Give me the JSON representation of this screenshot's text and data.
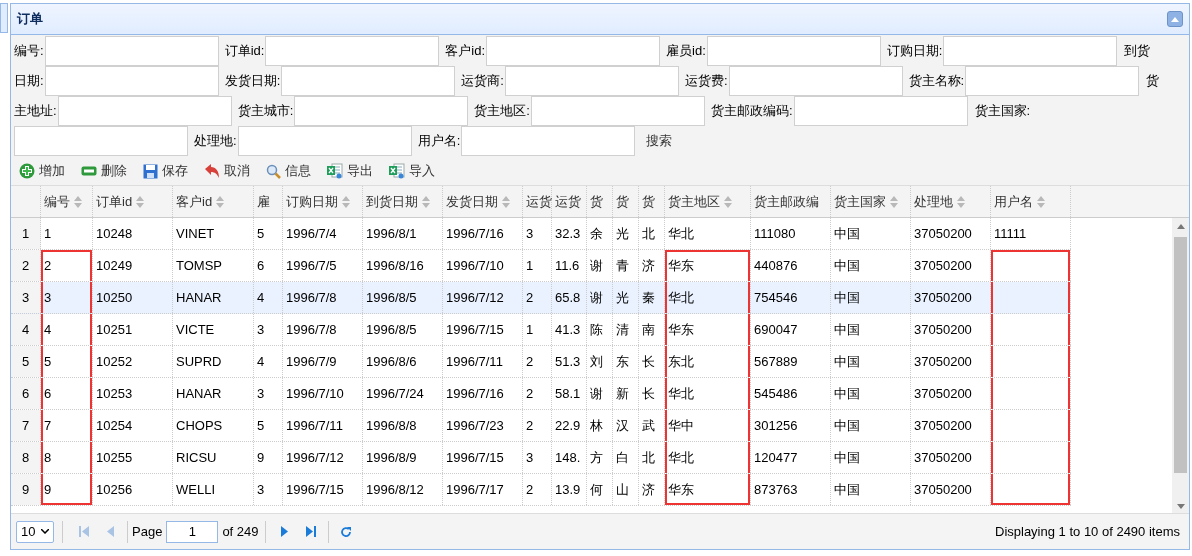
{
  "panel": {
    "title": "订单",
    "collapsed": false
  },
  "filter_rows": [
    [
      {
        "kind": "field",
        "label": "编号:"
      },
      {
        "kind": "field",
        "label": "订单id:"
      },
      {
        "kind": "field",
        "label": "客户id:"
      },
      {
        "kind": "field",
        "label": "雇员id:"
      },
      {
        "kind": "field",
        "label": "订购日期:"
      },
      {
        "kind": "label",
        "label": "到货"
      }
    ],
    [
      {
        "kind": "field",
        "label": "日期:"
      },
      {
        "kind": "field",
        "label": "发货日期:"
      },
      {
        "kind": "field",
        "label": "运货商:"
      },
      {
        "kind": "field",
        "label": "运货费:"
      },
      {
        "kind": "field",
        "label": "货主名称:"
      },
      {
        "kind": "label",
        "label": "货"
      }
    ],
    [
      {
        "kind": "field",
        "label": "主地址:"
      },
      {
        "kind": "field",
        "label": "货主城市:"
      },
      {
        "kind": "field",
        "label": "货主地区:"
      },
      {
        "kind": "field",
        "label": "货主邮政编码:"
      },
      {
        "kind": "label",
        "label": "货主国家:"
      }
    ],
    [
      {
        "kind": "input"
      },
      {
        "kind": "field",
        "label": "处理地:"
      },
      {
        "kind": "field",
        "label": "用户名:"
      },
      {
        "kind": "link",
        "label": "搜索"
      }
    ]
  ],
  "toolbar": [
    {
      "kind": "add",
      "label": "增加"
    },
    {
      "kind": "delete",
      "label": "删除"
    },
    {
      "kind": "save",
      "label": "保存"
    },
    {
      "kind": "cancel",
      "label": "取消"
    },
    {
      "kind": "info",
      "label": "信息"
    },
    {
      "kind": "export",
      "label": "导出"
    },
    {
      "kind": "import",
      "label": "导入"
    }
  ],
  "table": {
    "columns": [
      {
        "label": "编号",
        "sortable": true,
        "highlighted": true
      },
      {
        "label": "订单id",
        "sortable": true,
        "highlighted": false
      },
      {
        "label": "客户id",
        "sortable": true,
        "highlighted": false
      },
      {
        "label": "雇",
        "sortable": false,
        "highlighted": false
      },
      {
        "label": "订购日期",
        "sortable": true,
        "highlighted": false
      },
      {
        "label": "到货日期",
        "sortable": true,
        "highlighted": false
      },
      {
        "label": "发货日期",
        "sortable": true,
        "highlighted": false
      },
      {
        "label": "运货",
        "sortable": false,
        "highlighted": false
      },
      {
        "label": "运货",
        "sortable": false,
        "highlighted": false
      },
      {
        "label": "货",
        "sortable": false,
        "highlighted": false
      },
      {
        "label": "货",
        "sortable": false,
        "highlighted": false
      },
      {
        "label": "货",
        "sortable": false,
        "highlighted": false
      },
      {
        "label": "货主地区",
        "sortable": true,
        "highlighted": true
      },
      {
        "label": "货主邮政编",
        "sortable": false,
        "highlighted": false
      },
      {
        "label": "货主国家",
        "sortable": true,
        "highlighted": false
      },
      {
        "label": "处理地",
        "sortable": true,
        "highlighted": false
      },
      {
        "label": "用户名",
        "sortable": true,
        "highlighted": true
      }
    ],
    "rows": [
      {
        "number": "1",
        "selected": false,
        "highlighted": false,
        "cells": [
          "1",
          "10248",
          "VINET",
          "5",
          "1996/7/4",
          "1996/8/1",
          "1996/7/16",
          "3",
          "32.3",
          "余",
          "光",
          "北",
          "华北",
          "111080",
          "中国",
          "37050200",
          "11111"
        ]
      },
      {
        "number": "2",
        "selected": false,
        "highlighted": true,
        "cells": [
          "2",
          "10249",
          "TOMSP",
          "6",
          "1996/7/5",
          "1996/8/16",
          "1996/7/10",
          "1",
          "11.6",
          "谢",
          "青",
          "济",
          "华东",
          "440876",
          "中国",
          "37050200",
          ""
        ]
      },
      {
        "number": "3",
        "selected": true,
        "highlighted": true,
        "cells": [
          "3",
          "10250",
          "HANAR",
          "4",
          "1996/7/8",
          "1996/8/5",
          "1996/7/12",
          "2",
          "65.8",
          "谢",
          "光",
          "秦",
          "华北",
          "754546",
          "中国",
          "37050200",
          ""
        ]
      },
      {
        "number": "4",
        "selected": false,
        "highlighted": true,
        "cells": [
          "4",
          "10251",
          "VICTE",
          "3",
          "1996/7/8",
          "1996/8/5",
          "1996/7/15",
          "1",
          "41.3",
          "陈",
          "清",
          "南",
          "华东",
          "690047",
          "中国",
          "37050200",
          ""
        ]
      },
      {
        "number": "5",
        "selected": false,
        "highlighted": true,
        "cells": [
          "5",
          "10252",
          "SUPRD",
          "4",
          "1996/7/9",
          "1996/8/6",
          "1996/7/11",
          "2",
          "51.3",
          "刘",
          "东",
          "长",
          "东北",
          "567889",
          "中国",
          "37050200",
          ""
        ]
      },
      {
        "number": "6",
        "selected": false,
        "highlighted": true,
        "cells": [
          "6",
          "10253",
          "HANAR",
          "3",
          "1996/7/10",
          "1996/7/24",
          "1996/7/16",
          "2",
          "58.1",
          "谢",
          "新",
          "长",
          "华北",
          "545486",
          "中国",
          "37050200",
          ""
        ]
      },
      {
        "number": "7",
        "selected": false,
        "highlighted": true,
        "cells": [
          "7",
          "10254",
          "CHOPS",
          "5",
          "1996/7/11",
          "1996/8/8",
          "1996/7/23",
          "2",
          "22.9",
          "林",
          "汉",
          "武",
          "华中",
          "301256",
          "中国",
          "37050200",
          ""
        ]
      },
      {
        "number": "8",
        "selected": false,
        "highlighted": true,
        "cells": [
          "8",
          "10255",
          "RICSU",
          "9",
          "1996/7/12",
          "1996/8/9",
          "1996/7/15",
          "3",
          "148.",
          "方",
          "白",
          "北",
          "华北",
          "120477",
          "中国",
          "37050200",
          ""
        ]
      },
      {
        "number": "9",
        "selected": false,
        "highlighted": true,
        "cells": [
          "9",
          "10256",
          "WELLI",
          "3",
          "1996/7/15",
          "1996/8/12",
          "1996/7/17",
          "2",
          "13.9",
          "何",
          "山",
          "济",
          "华东",
          "873763",
          "中国",
          "37050200",
          ""
        ]
      }
    ]
  },
  "pager": {
    "page_size": "10",
    "page_label": "Page",
    "page": "1",
    "of_label": "of 249",
    "summary": "Displaying 1 to 10 of 2490 items",
    "buttons": [
      {
        "kind": "first",
        "disabled": true
      },
      {
        "kind": "prev",
        "disabled": true
      },
      {
        "kind": "next",
        "disabled": false
      },
      {
        "kind": "last",
        "disabled": false
      },
      {
        "kind": "refresh",
        "disabled": false
      }
    ]
  }
}
